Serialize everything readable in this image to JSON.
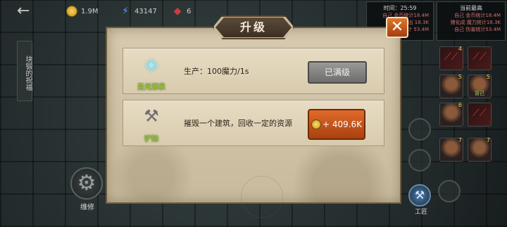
{
  "hud": {
    "back_icon": "back-arrow-icon",
    "gold": "1.9M",
    "mana": "43147",
    "blood": "6"
  },
  "stats": {
    "timer_label": "时间：25:59",
    "current_high": "当前最高",
    "left_lines": [
      "自己 金币统计18.4M",
      "自己 产出 18.3K",
      "自己 伤害统计 53.4M"
    ],
    "right_lines": [
      "自己 金币统计18.4M",
      "猪化成 魔力统计18.3K",
      "自己 伤害统计53.4M"
    ]
  },
  "side_tab": {
    "label": "块锻的祝福"
  },
  "repair": {
    "label": "维修",
    "icon": "gear-icon"
  },
  "craft": {
    "label": "工匠"
  },
  "shovel_tip": {
    "label": "铲子"
  },
  "modal": {
    "title": "升级",
    "close_icon": "close-icon",
    "rows": [
      {
        "icon": "crystal-tower-icon",
        "name": "圣光源泉",
        "desc": "生产：100魔力/1s",
        "button": "已满级"
      },
      {
        "icon": "shovel-icon",
        "name": "铲除",
        "desc": "摧毁一个建筑，回收一定的资源",
        "button": "+ 409.6K"
      }
    ]
  },
  "right_panel": {
    "levels": [
      "4",
      "5",
      "5",
      "6",
      "7",
      "7"
    ],
    "portrait_tag": "盲己"
  },
  "colors": {
    "accent_orange": "#e06a2a",
    "parchment": "#cfc3a6",
    "green_name": "#9ec73f"
  }
}
